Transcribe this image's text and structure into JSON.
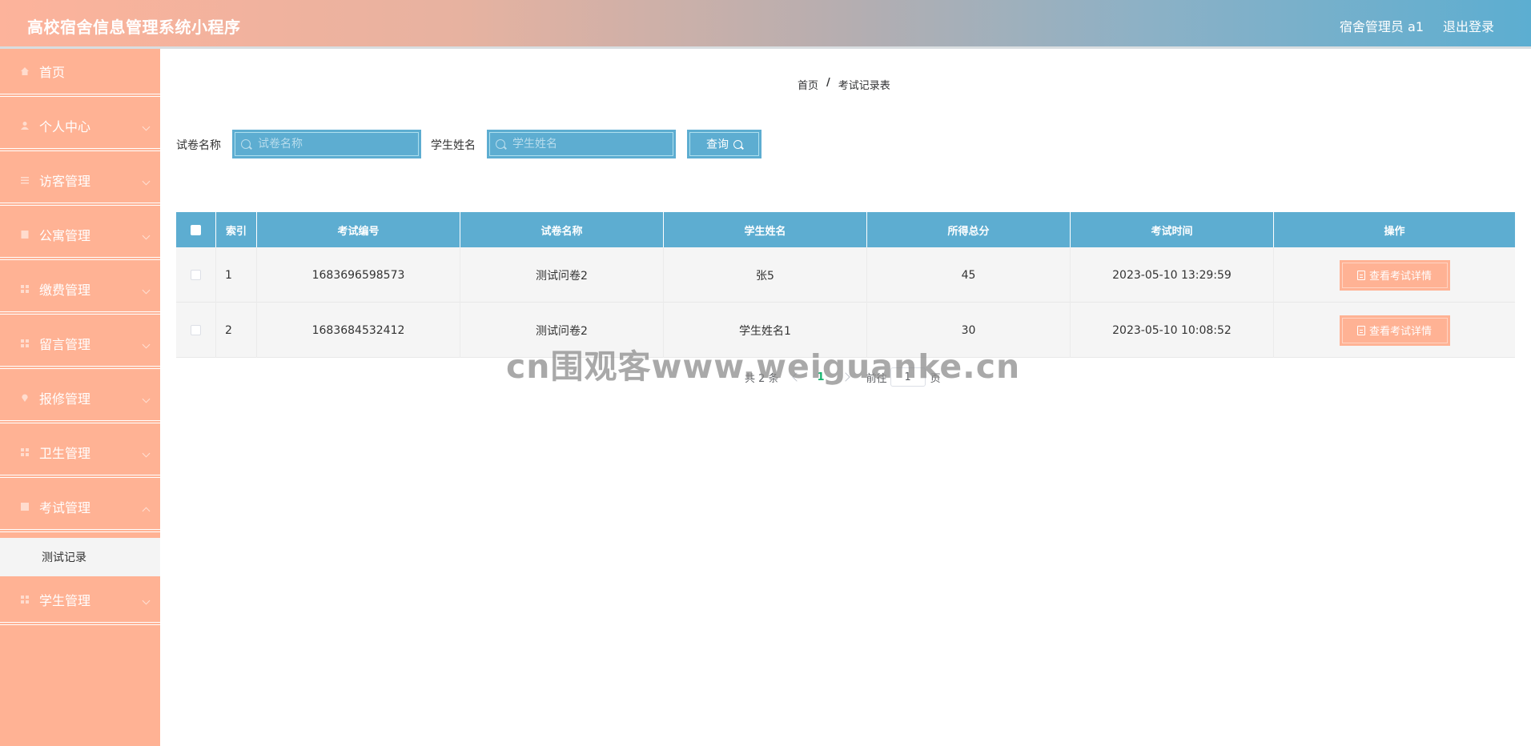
{
  "header": {
    "title": "高校宿舍信息管理系统小程序",
    "user": "宿舍管理员 a1",
    "logout": "退出登录"
  },
  "sidebar": {
    "items": [
      {
        "label": "首页",
        "icon": "home-icon"
      },
      {
        "label": "个人中心",
        "icon": "user-icon"
      },
      {
        "label": "访客管理",
        "icon": "list-icon"
      },
      {
        "label": "公寓管理",
        "icon": "building-icon"
      },
      {
        "label": "缴费管理",
        "icon": "grid-icon"
      },
      {
        "label": "留言管理",
        "icon": "grid-icon"
      },
      {
        "label": "报修管理",
        "icon": "location-icon"
      },
      {
        "label": "卫生管理",
        "icon": "grid-icon"
      },
      {
        "label": "考试管理",
        "icon": "grid-icon"
      },
      {
        "label": "学生管理",
        "icon": "grid-icon"
      }
    ],
    "submenu": "测试记录"
  },
  "breadcrumb": {
    "home": "首页",
    "separator": "/",
    "current": "考试记录表"
  },
  "search": {
    "paper_label": "试卷名称",
    "paper_placeholder": "试卷名称",
    "student_label": "学生姓名",
    "student_placeholder": "学生姓名",
    "query_label": "查询"
  },
  "table": {
    "headers": [
      "索引",
      "考试编号",
      "试卷名称",
      "学生姓名",
      "所得总分",
      "考试时间",
      "操作"
    ],
    "rows": [
      {
        "index": "1",
        "exam_no": "1683696598573",
        "paper": "测试问卷2",
        "student": "张5",
        "score": "45",
        "time": "2023-05-10 13:29:59",
        "action": "查看考试详情"
      },
      {
        "index": "2",
        "exam_no": "1683684532412",
        "paper": "测试问卷2",
        "student": "学生姓名1",
        "score": "30",
        "time": "2023-05-10 10:08:52",
        "action": "查看考试详情"
      }
    ]
  },
  "pagination": {
    "total": "共 2 条",
    "current_page": "1",
    "goto_label": "前往",
    "goto_value": "1",
    "page_unit": "页"
  },
  "watermark": "cn围观客www.weiguanke.cn",
  "colors": {
    "sidebar": "#ffb294",
    "accent_blue": "#5dadd1",
    "page_active": "#16b36e"
  }
}
